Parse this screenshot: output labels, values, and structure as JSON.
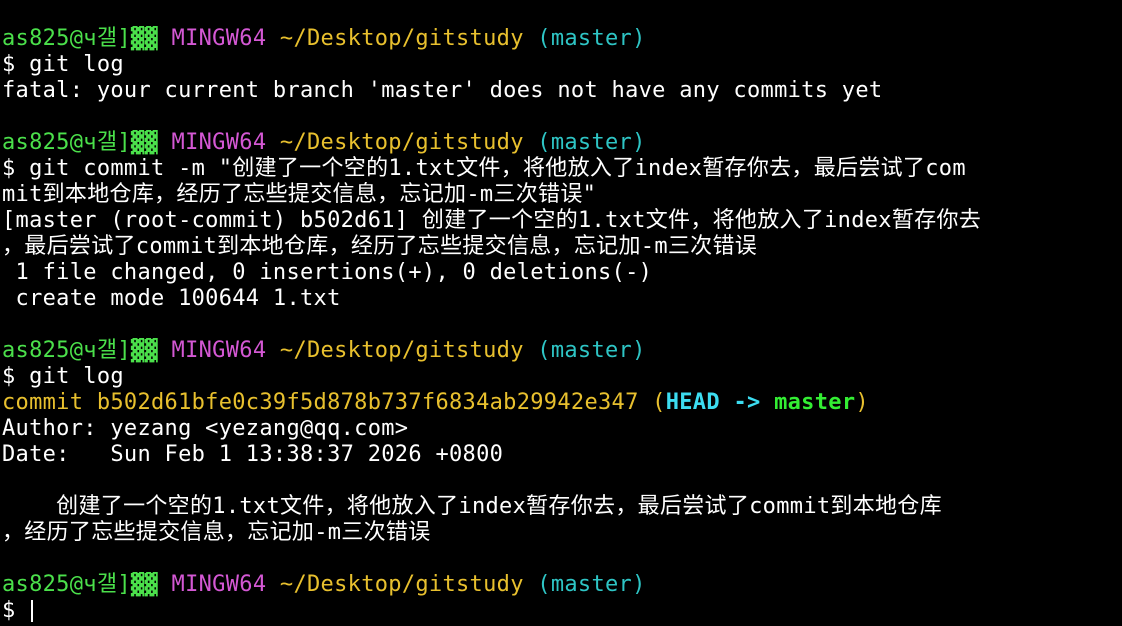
{
  "prompt": {
    "user_host": "as825@ч갤",
    "bracket": "]▓▓",
    "system": "MINGW64",
    "path": "~/Desktop/gitstudy",
    "branch": "(master)",
    "dollar": "$ "
  },
  "lines": {
    "cmd1": "git log",
    "out1": "fatal: your current branch 'master' does not have any commits yet",
    "cmd2_a": "git commit -m \"创建了一个空的1.txt文件，将他放入了index暂存你去，最后尝试了com",
    "cmd2_b": "mit到本地仓库，经历了忘些提交信息，忘记加-m三次错误\"",
    "out2_a": "[master (root-commit) b502d61] 创建了一个空的1.txt文件，将他放入了index暂存你去",
    "out2_b": "，最后尝试了commit到本地仓库，经历了忘些提交信息，忘记加-m三次错误",
    "out2_c": " 1 file changed, 0 insertions(+), 0 deletions(-)",
    "out2_d": " create mode 100644 1.txt",
    "cmd3": "git log",
    "commit_label": "commit b502d61bfe0c39f5d878b737f6834ab29942e347",
    "ref_open": " (",
    "ref_head": "HEAD -> ",
    "ref_branch": "master",
    "ref_close": ")",
    "author": "Author: yezang <yezang@qq.com>",
    "date": "Date:   Sun Feb 1 13:38:37 2026 +0800",
    "msg_a": "    创建了一个空的1.txt文件，将他放入了index暂存你去，最后尝试了commit到本地仓库",
    "msg_b": "，经历了忘些提交信息，忘记加-m三次错误"
  },
  "colors": {
    "background": "#000000",
    "prompt_green": "#4be04b",
    "prompt_magenta": "#d458d4",
    "prompt_yellow": "#e8c02e",
    "prompt_cyan": "#2ec5c5"
  }
}
